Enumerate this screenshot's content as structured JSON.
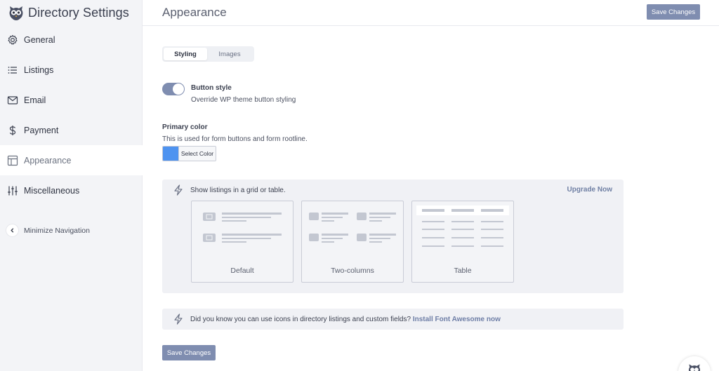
{
  "brand": {
    "title": "Directory Settings",
    "logo_icon": "owl-logo-icon"
  },
  "sidebar": {
    "items": [
      {
        "label": "General",
        "icon": "gear-icon"
      },
      {
        "label": "Listings",
        "icon": "list-icon"
      },
      {
        "label": "Email",
        "icon": "envelope-icon"
      },
      {
        "label": "Payment",
        "icon": "dollar-icon"
      },
      {
        "label": "Appearance",
        "icon": "layout-icon",
        "active": true
      },
      {
        "label": "Miscellaneous",
        "icon": "sliders-icon"
      }
    ],
    "minimize_label": "Minimize Navigation"
  },
  "header": {
    "title": "Appearance",
    "save_label": "Save Changes"
  },
  "tabs": [
    {
      "label": "Styling",
      "active": true
    },
    {
      "label": "Images",
      "active": false
    }
  ],
  "button_style": {
    "title": "Button style",
    "description": "Override WP theme button styling",
    "enabled": true
  },
  "primary_color": {
    "title": "Primary color",
    "description": "This is used for form buttons and form rootline.",
    "picker_label": "Select Color",
    "value": "#4e93f0"
  },
  "layout_panel": {
    "title": "Show listings in a grid or table.",
    "upgrade_label": "Upgrade Now",
    "options": [
      {
        "label": "Default"
      },
      {
        "label": "Two-columns"
      },
      {
        "label": "Table"
      }
    ]
  },
  "tip": {
    "text": "Did you know you can use icons in directory listings and custom fields?",
    "link_label": "Install Font Awesome now"
  },
  "footer": {
    "save_label": "Save Changes"
  },
  "colors": {
    "accent": "#7f8db0",
    "sidebar_bg": "#f3f4f7",
    "panel_bg": "#f0f1f5"
  }
}
